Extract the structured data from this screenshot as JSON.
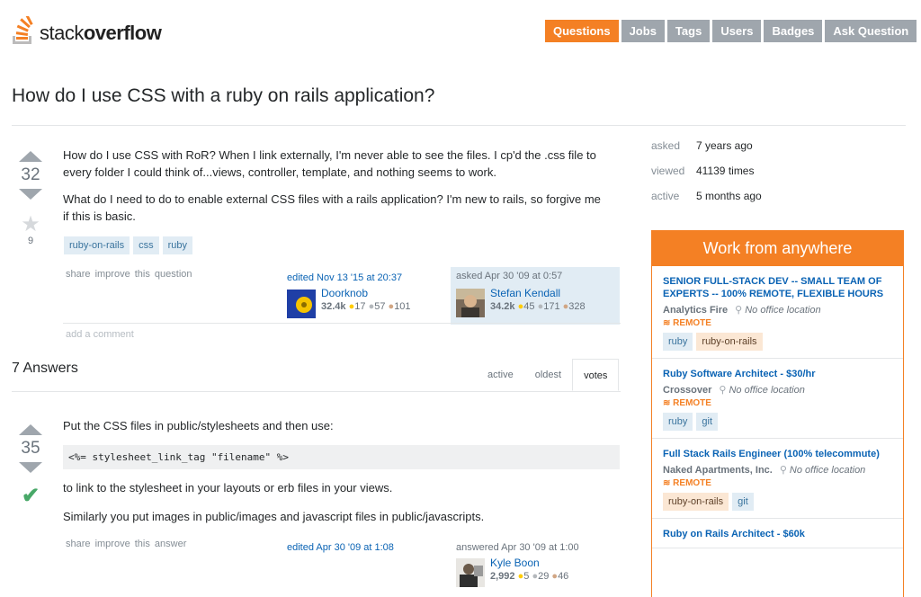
{
  "brand": {
    "name_light": "stack",
    "name_bold": "overflow"
  },
  "nav": [
    {
      "label": "Questions",
      "active": true
    },
    {
      "label": "Jobs"
    },
    {
      "label": "Tags"
    },
    {
      "label": "Users"
    },
    {
      "label": "Badges"
    },
    {
      "label": "Ask Question"
    }
  ],
  "question": {
    "title": "How do I use CSS with a ruby on rails application?",
    "votes": "32",
    "favorites": "9",
    "paragraphs": [
      "How do I use CSS with RoR? When I link externally, I'm never able to see the files. I cp'd the .css file to every folder I could think of...views, controller, template, and nothing seems to work.",
      "What do I need to do to enable external CSS files with a rails application? I'm new to rails, so forgive me if this is basic."
    ],
    "tags": [
      "ruby-on-rails",
      "css",
      "ruby"
    ],
    "menu": "share  improve this question",
    "editor": {
      "action": "edited Nov 13 '15 at 20:37",
      "name": "Doorknob",
      "rep": "32.4k",
      "gold": "17",
      "silver": "57",
      "bronze": "101"
    },
    "owner": {
      "action": "asked Apr 30 '09 at 0:57",
      "name": "Stefan Kendall",
      "rep": "34.2k",
      "gold": "45",
      "silver": "171",
      "bronze": "328"
    },
    "add_comment": "add a comment"
  },
  "answers_header": {
    "count_label": "7 Answers",
    "tabs": [
      {
        "label": "active"
      },
      {
        "label": "oldest"
      },
      {
        "label": "votes",
        "active": true
      }
    ]
  },
  "answer": {
    "votes": "35",
    "line1": "Put the CSS files in public/stylesheets and then use:",
    "code": "<%= stylesheet_link_tag \"filename\" %>",
    "line2": "to link to the stylesheet in your layouts or erb files in your views.",
    "line3": "Similarly you put images in public/images and javascript files in public/javascripts.",
    "menu": "share  improve this answer",
    "edited": "edited Apr 30 '09 at 1:08",
    "author": {
      "action": "answered Apr 30 '09 at 1:00",
      "name": "Kyle Boon",
      "rep": "2,992",
      "gold": "5",
      "silver": "29",
      "bronze": "46"
    }
  },
  "stats": [
    {
      "label": "asked",
      "value": "7 years ago"
    },
    {
      "label": "viewed",
      "value": "41139 times"
    },
    {
      "label": "active",
      "value": "5 months ago"
    }
  ],
  "jobs": {
    "heading": "Work from anywhere",
    "items": [
      {
        "title": "SENIOR FULL-STACK DEV -- SMALL TEAM OF EXPERTS -- 100% REMOTE, FLEXIBLE HOURS",
        "company": "Analytics Fire",
        "location": "No office location",
        "remote": "REMOTE",
        "tags": [
          "ruby",
          "ruby-on-rails"
        ],
        "hl": [
          false,
          true
        ]
      },
      {
        "title": "Ruby Software Architect - $30/hr",
        "company": "Crossover",
        "location": "No office location",
        "remote": "REMOTE",
        "tags": [
          "ruby",
          "git"
        ],
        "hl": [
          false,
          false
        ]
      },
      {
        "title": "Full Stack Rails Engineer (100% telecommute)",
        "company": "Naked Apartments, Inc.",
        "location": "No office location",
        "remote": "REMOTE",
        "tags": [
          "ruby-on-rails",
          "git"
        ],
        "hl": [
          true,
          false
        ]
      },
      {
        "title": "Ruby on Rails Architect - $60k"
      }
    ]
  },
  "colors": {
    "accent": "#f48024",
    "link": "#0a63b4",
    "accepted": "#48a868"
  }
}
